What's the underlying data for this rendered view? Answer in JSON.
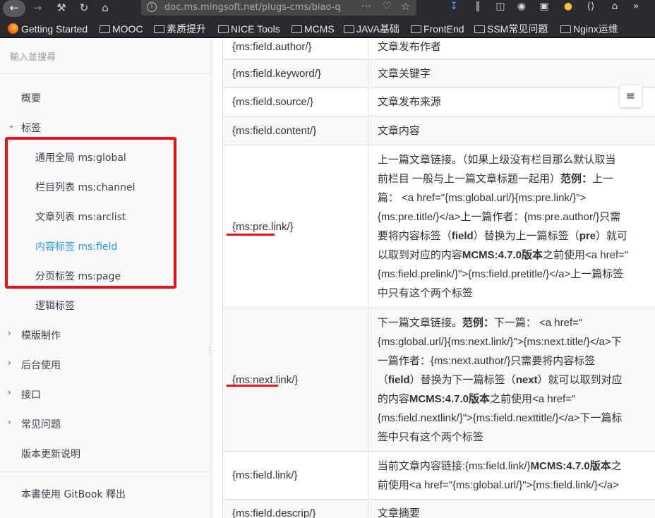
{
  "browser": {
    "url": "doc.ms.mingsoft.net/plugs-cms/biao-q",
    "bookmarks": [
      "Getting Started",
      "MOOC",
      "素质提升",
      "NICE Tools",
      "MCMS",
      "JAVA基础",
      "FrontEnd",
      "SSM常见问题",
      "Nginx运维"
    ]
  },
  "sidebar": {
    "search_placeholder": "輸入並搜尋",
    "items": [
      {
        "label": "概要"
      },
      {
        "label": "标签"
      },
      {
        "label": "通用全局 ms:global"
      },
      {
        "label": "栏目列表 ms:channel"
      },
      {
        "label": "文章列表 ms:arclist"
      },
      {
        "label": "内容标签 ms:field"
      },
      {
        "label": "分页标签 ms:page"
      },
      {
        "label": "逻辑标签"
      },
      {
        "label": "模版制作"
      },
      {
        "label": "后台使用"
      },
      {
        "label": "接口"
      },
      {
        "label": "常见问题"
      },
      {
        "label": "版本更新说明"
      }
    ],
    "footer": "本書使用 GitBook 釋出"
  },
  "table": {
    "rows": [
      {
        "tag": "{ms:field.author/}",
        "desc": "文章发布作者"
      },
      {
        "tag": "{ms:field.keyword/}",
        "desc": "文章关键字"
      },
      {
        "tag": "{ms:field.source/}",
        "desc": "文章发布来源"
      },
      {
        "tag": "{ms:field.content/}",
        "desc": "文章内容"
      },
      {
        "tag": "{ms:pre.link/}",
        "desc_lines": [
          "上一篇文章链接。（如果上级没有栏目那么默认取当",
          "前栏目 一般与上一篇文章标题一起用）",
          "范例：",
          "上一",
          "篇： <a href=\"{ms:global.url/}{ms:pre.link/}\">",
          "{ms:pre.title/}</a>上一篇作者：{ms:pre.author/}只需",
          "要将内容标签（",
          "field",
          "）替换为上一篇标签（",
          "pre",
          "）就可",
          "以取到对应的内容",
          "MCMS:4.7.0版本",
          "之前使用<a href=\"",
          "{ms:field.prelink/}\">{ms:field.pretitle/}</a>上一篇标签",
          "中只有这个两个标签"
        ]
      },
      {
        "tag": "{ms:next.link/}",
        "desc_lines": [
          "下一篇文章链接。",
          "范例：",
          "下一篇： <a href=\"",
          "{ms:global.url/}{ms:next.link/}\">{ms:next.title/}</a>下",
          "一篇作者：{ms:next.author/}只需要将内容标签",
          "（",
          "field",
          "）替换为下一篇标签（",
          "next",
          "）就可以取到对应",
          "的内容",
          "MCMS:4.7.0版本",
          "之前使用<a href=\"",
          "{ms:field.nextlink/}\">{ms:field.nexttitle/}</a>下一篇标",
          "签中只有这个两个标签"
        ]
      },
      {
        "tag": "{ms:field.link/}",
        "desc_lines": [
          "当前文章内容链接:{ms:field.link/}",
          "MCMS:4.7.0版本",
          "之",
          "前使用<a href=\"{ms:global.url/}\">{ms:field.link/}</a>"
        ]
      },
      {
        "tag": "{ms:field.descrip/}",
        "desc": "文章摘要"
      }
    ]
  },
  "menu_icon": "≡"
}
